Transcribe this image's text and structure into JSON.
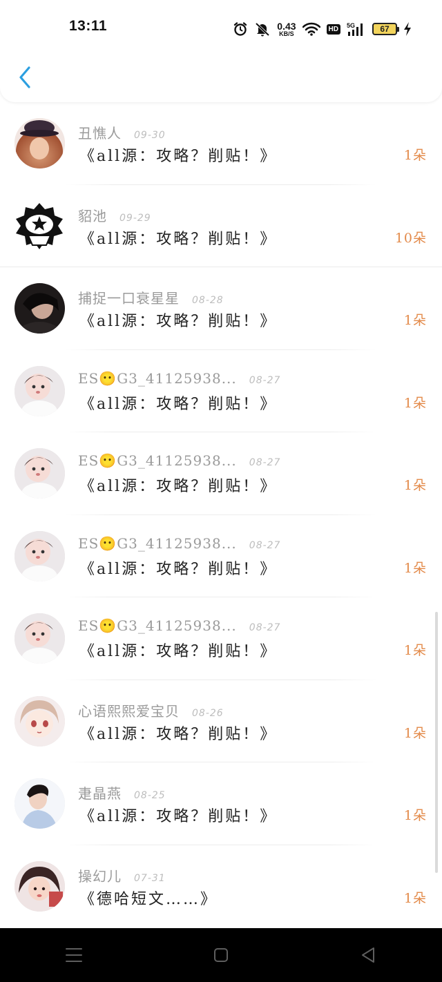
{
  "status_bar": {
    "time": "13:11",
    "net_speed_value": "0.43",
    "net_speed_unit": "KB/S",
    "hd_label": "HD",
    "signal_label": "5G",
    "battery_level": "67",
    "icons": [
      "alarm-icon",
      "mute-bell-icon",
      "wifi-icon",
      "hd-icon",
      "signal-5g-icon",
      "battery-icon",
      "charging-icon"
    ]
  },
  "header": {
    "back_icon": "chevron-left-icon",
    "accent_color": "#2c9fe0"
  },
  "list": {
    "count_color": "#e38a4a",
    "items": [
      {
        "username": "丑憔人",
        "date": "09-30",
        "title": "《all源：攻略？削贴！》",
        "count": "1朵",
        "avatar": "a1"
      },
      {
        "username": "貂池",
        "date": "09-29",
        "title": "《all源：攻略？削贴！》",
        "count": "10朵",
        "avatar": "a2"
      },
      {
        "username": "捕捉一口衰星星",
        "date": "08-28",
        "title": "《all源：攻略？削贴！》",
        "count": "1朵",
        "avatar": "a3"
      },
      {
        "username": "ES😶G3_41125938...",
        "date": "08-27",
        "title": "《all源：攻略？削贴！》",
        "count": "1朵",
        "avatar": "a4"
      },
      {
        "username": "ES😶G3_41125938...",
        "date": "08-27",
        "title": "《all源：攻略？削贴！》",
        "count": "1朵",
        "avatar": "a4"
      },
      {
        "username": "ES😶G3_41125938...",
        "date": "08-27",
        "title": "《all源：攻略？削贴！》",
        "count": "1朵",
        "avatar": "a4"
      },
      {
        "username": "ES😶G3_41125938...",
        "date": "08-27",
        "title": "《all源：攻略？削贴！》",
        "count": "1朵",
        "avatar": "a4"
      },
      {
        "username": "心语熙熙爱宝贝",
        "date": "08-26",
        "title": "《all源：攻略？削贴！》",
        "count": "1朵",
        "avatar": "a5"
      },
      {
        "username": "疌晶燕",
        "date": "08-25",
        "title": "《all源：攻略？削贴！》",
        "count": "1朵",
        "avatar": "a6"
      },
      {
        "username": "操幻儿",
        "date": "07-31",
        "title": "《德哈短文……》",
        "count": "1朵",
        "avatar": "a7"
      }
    ]
  },
  "navbar": {
    "icons": [
      "menu-icon",
      "home-square-icon",
      "back-triangle-icon"
    ]
  }
}
